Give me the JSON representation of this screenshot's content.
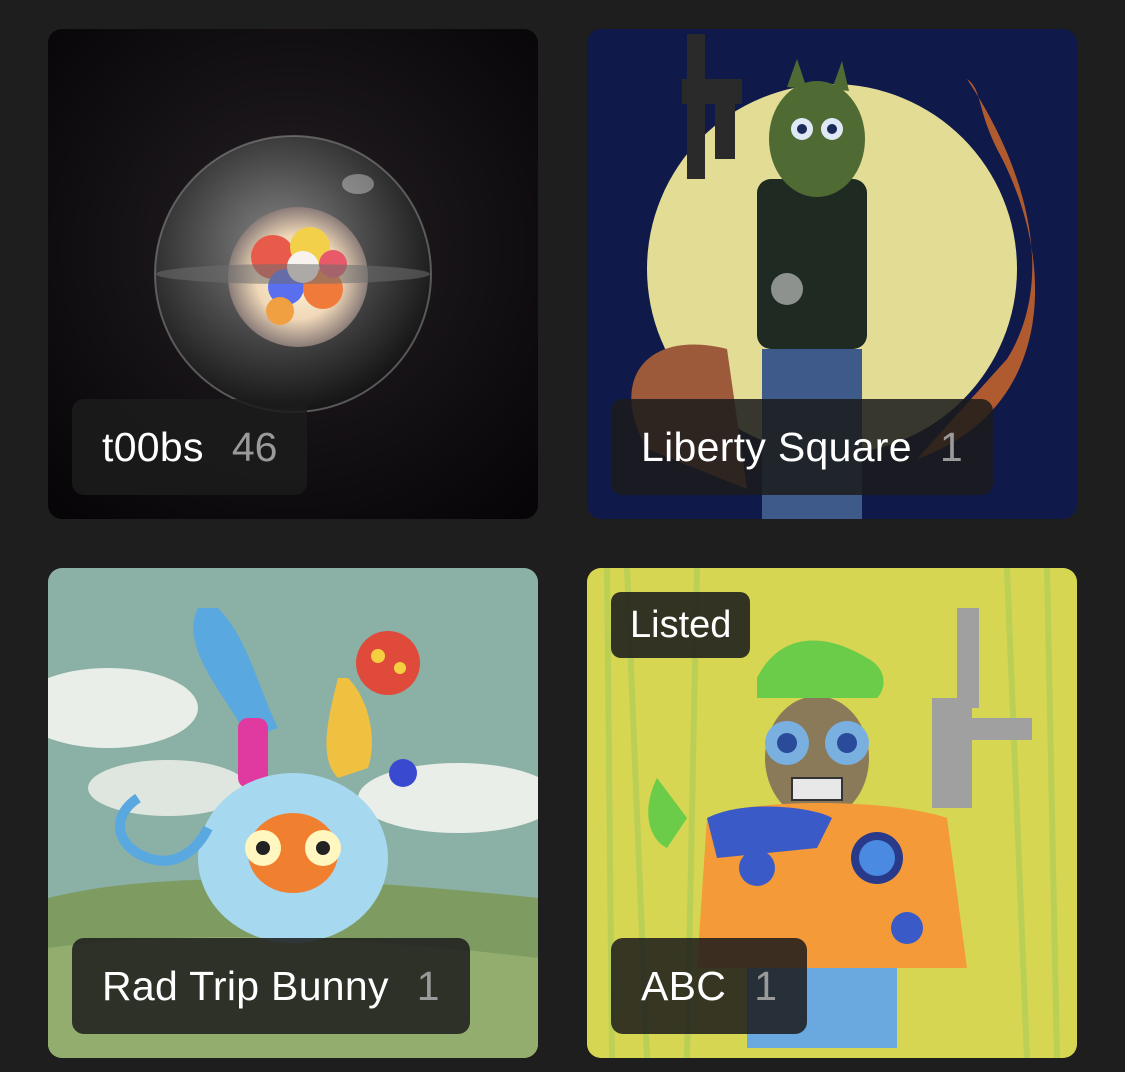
{
  "collections": [
    {
      "name": "t00bs",
      "count": "46",
      "art_icon": "glass-orb-image"
    },
    {
      "name": "Liberty Square",
      "count": "1",
      "art_icon": "armed-squirrel-image"
    },
    {
      "name": "Rad Trip Bunny",
      "count": "1",
      "art_icon": "bunny-creature-image"
    },
    {
      "name": "ABC",
      "count": "1",
      "art_icon": "crayon-character-image",
      "badge": "Listed"
    }
  ],
  "colors": {
    "background": "#1e1e1e",
    "pill_background": "#1c1c1c",
    "name_text": "#ffffff",
    "count_text": "#9a9a9a"
  }
}
